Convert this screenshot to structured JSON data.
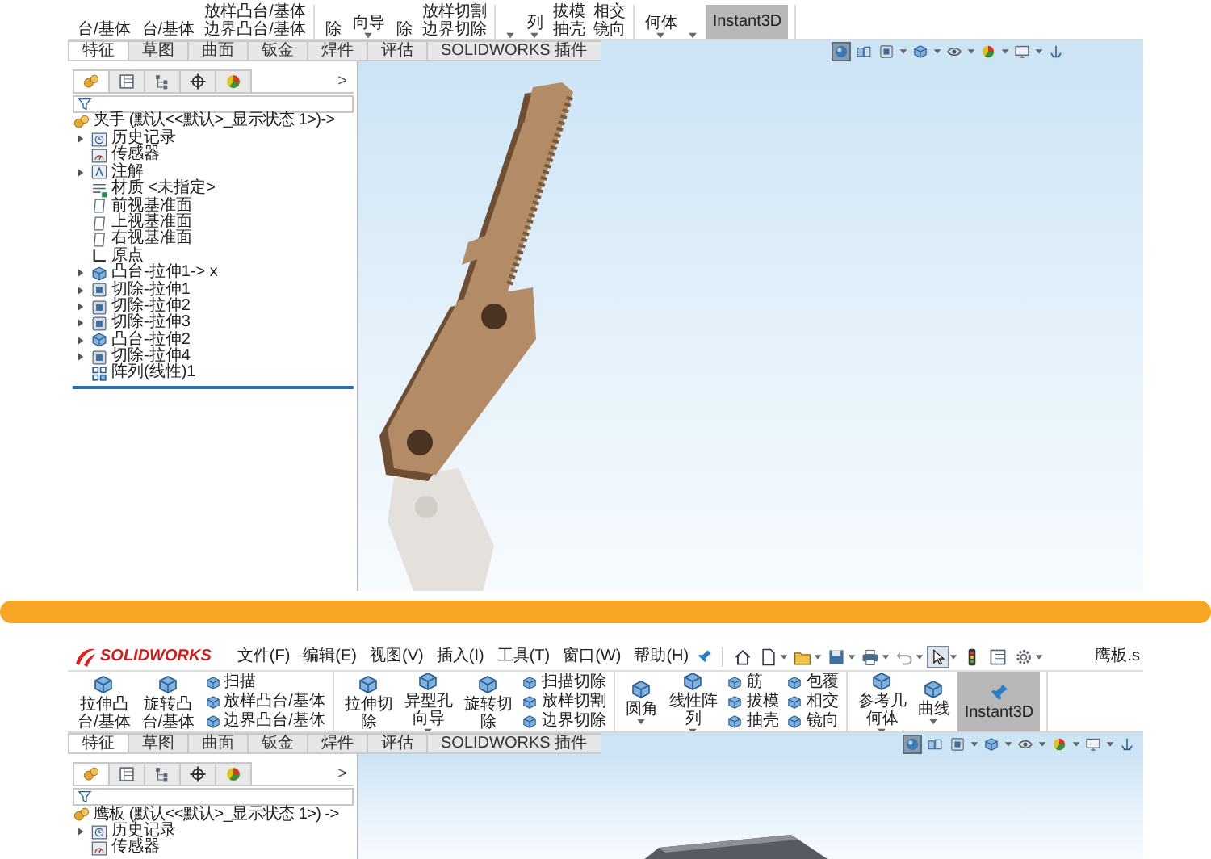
{
  "top_view": {
    "ribbon": {
      "groups": [
        [
          {
            "kind": "large",
            "lines": [
              "台/基体"
            ],
            "dropdown": false,
            "on": false
          },
          {
            "kind": "large",
            "lines": [
              "台/基体"
            ],
            "dropdown": false,
            "on": false
          },
          {
            "kind": "stack",
            "items": [
              "放样凸台/基体",
              "边界凸台/基体"
            ]
          }
        ],
        [
          {
            "kind": "large",
            "lines": [
              "除"
            ],
            "dropdown": false,
            "on": false
          },
          {
            "kind": "large",
            "lines": [
              "向导"
            ],
            "dropdown": true,
            "on": false
          },
          {
            "kind": "large",
            "lines": [
              "除"
            ],
            "dropdown": false,
            "on": false
          },
          {
            "kind": "stack",
            "items": [
              "放样切割",
              "边界切除"
            ]
          }
        ],
        [
          {
            "kind": "large",
            "dropdown": true,
            "on": false
          },
          {
            "kind": "large",
            "lines": [
              "列"
            ],
            "dropdown": true,
            "on": false
          },
          {
            "kind": "stack",
            "items": [
              "拔模",
              "抽壳"
            ]
          },
          {
            "kind": "stack",
            "items": [
              "相交",
              "镜向"
            ]
          }
        ],
        [
          {
            "kind": "large",
            "lines": [
              "何体"
            ],
            "dropdown": true,
            "on": false
          },
          {
            "kind": "large",
            "dropdown": true,
            "on": false
          },
          {
            "kind": "large",
            "lines": [
              "Instant3D"
            ],
            "dropdown": false,
            "on": true
          }
        ]
      ]
    },
    "tabs": [
      {
        "label": "特征",
        "selected": true
      },
      {
        "label": "草图",
        "selected": false
      },
      {
        "label": "曲面",
        "selected": false
      },
      {
        "label": "钣金",
        "selected": false
      },
      {
        "label": "焊件",
        "selected": false
      },
      {
        "label": "评估",
        "selected": false
      },
      {
        "label": "SOLIDWORKS 插件",
        "selected": false
      }
    ],
    "view_tools": [
      {
        "kind": "sphere",
        "selected": true,
        "dropdown": false
      },
      {
        "kind": "cubes",
        "selected": false,
        "dropdown": false
      },
      {
        "kind": "box",
        "selected": false,
        "dropdown": true
      },
      {
        "kind": "cube",
        "selected": false,
        "dropdown": true
      },
      {
        "kind": "eye",
        "selected": false,
        "dropdown": true
      },
      {
        "kind": "ball",
        "selected": false,
        "dropdown": true
      },
      {
        "kind": "monitor",
        "selected": false,
        "dropdown": true
      },
      {
        "kind": "anchor",
        "selected": false,
        "dropdown": false
      }
    ],
    "panel": {
      "tabs": [
        {
          "kind": "parts",
          "selected": true
        },
        {
          "kind": "window",
          "selected": false
        },
        {
          "kind": "nodes",
          "selected": false
        },
        {
          "kind": "crosshair",
          "selected": false
        },
        {
          "kind": "ball",
          "selected": false
        }
      ],
      "more": ">",
      "root": "夹手 (默认<<默认>_显示状态 1>)->",
      "items": [
        {
          "kind": "clock",
          "label": "历史记录",
          "expandable": true
        },
        {
          "kind": "gauge",
          "label": "传感器",
          "expandable": false
        },
        {
          "kind": "triangle",
          "label": "注解",
          "expandable": true
        },
        {
          "kind": "list",
          "label": "材质 <未指定>",
          "expandable": false
        },
        {
          "kind": "plane",
          "label": "前视基准面",
          "expandable": false
        },
        {
          "kind": "plane",
          "label": "上视基准面",
          "expandable": false
        },
        {
          "kind": "plane",
          "label": "右视基准面",
          "expandable": false
        },
        {
          "kind": "axes",
          "label": "原点",
          "expandable": false
        },
        {
          "kind": "cube",
          "label": "凸台-拉伸1-> x",
          "expandable": true
        },
        {
          "kind": "box",
          "label": "切除-拉伸1",
          "expandable": true
        },
        {
          "kind": "box",
          "label": "切除-拉伸2",
          "expandable": true
        },
        {
          "kind": "box",
          "label": "切除-拉伸3",
          "expandable": true
        },
        {
          "kind": "cube",
          "label": "凸台-拉伸2",
          "expandable": true
        },
        {
          "kind": "box",
          "label": "切除-拉伸4",
          "expandable": true
        },
        {
          "kind": "grid",
          "label": "阵列(线性)1",
          "expandable": false
        }
      ]
    }
  },
  "bottom_view": {
    "title_bar": {
      "logo": "SOLIDWORKS",
      "menus": [
        "文件(F)",
        "编辑(E)",
        "视图(V)",
        "插入(I)",
        "工具(T)",
        "窗口(W)",
        "帮助(H)"
      ],
      "quick_access": [
        {
          "kind": "home",
          "selected": false,
          "dropdown": false
        },
        {
          "kind": "page",
          "selected": false,
          "dropdown": true
        },
        {
          "kind": "folder",
          "selected": false,
          "dropdown": true
        },
        {
          "kind": "disk",
          "selected": false,
          "dropdown": true
        },
        {
          "kind": "printer",
          "selected": false,
          "dropdown": true
        },
        {
          "kind": "undo",
          "selected": false,
          "dropdown": true
        },
        {
          "kind": "cursor",
          "selected": true,
          "dropdown": true
        },
        {
          "kind": "light",
          "selected": false,
          "dropdown": false
        },
        {
          "kind": "window",
          "selected": false,
          "dropdown": false
        },
        {
          "kind": "gear",
          "selected": false,
          "dropdown": true
        }
      ],
      "document": "鹰板.s"
    },
    "ribbon": {
      "groups": [
        [
          {
            "kind": "large",
            "lines": [
              "拉伸凸",
              "台/基体"
            ],
            "dropdown": false,
            "on": false
          },
          {
            "kind": "large",
            "lines": [
              "旋转凸",
              "台/基体"
            ],
            "dropdown": false,
            "on": false
          },
          {
            "kind": "stack",
            "items": [
              "扫描",
              "放样凸台/基体",
              "边界凸台/基体"
            ]
          }
        ],
        [
          {
            "kind": "large",
            "lines": [
              "拉伸切",
              "除"
            ],
            "dropdown": false,
            "on": false
          },
          {
            "kind": "large",
            "lines": [
              "异型孔",
              "向导"
            ],
            "dropdown": true,
            "on": false
          },
          {
            "kind": "large",
            "lines": [
              "旋转切",
              "除"
            ],
            "dropdown": false,
            "on": false
          },
          {
            "kind": "stack",
            "items": [
              "扫描切除",
              "放样切割",
              "边界切除"
            ]
          }
        ],
        [
          {
            "kind": "large",
            "lines": [
              "圆角"
            ],
            "dropdown": true,
            "on": false
          },
          {
            "kind": "large",
            "lines": [
              "线性阵",
              "列"
            ],
            "dropdown": true,
            "on": false
          },
          {
            "kind": "stack",
            "items": [
              "筋",
              "拔模",
              "抽壳"
            ]
          },
          {
            "kind": "stack",
            "items": [
              "包覆",
              "相交",
              "镜向"
            ]
          }
        ],
        [
          {
            "kind": "large",
            "lines": [
              "参考几",
              "何体"
            ],
            "dropdown": true,
            "on": false
          },
          {
            "kind": "large",
            "lines": [
              "曲线"
            ],
            "dropdown": true,
            "on": false
          },
          {
            "kind": "large",
            "lines": [
              "Instant3D"
            ],
            "dropdown": false,
            "on": true
          }
        ]
      ]
    },
    "tabs": [
      {
        "label": "特征",
        "selected": true
      },
      {
        "label": "草图",
        "selected": false
      },
      {
        "label": "曲面",
        "selected": false
      },
      {
        "label": "钣金",
        "selected": false
      },
      {
        "label": "焊件",
        "selected": false
      },
      {
        "label": "评估",
        "selected": false
      },
      {
        "label": "SOLIDWORKS 插件",
        "selected": false
      }
    ],
    "view_tools": [
      {
        "kind": "sphere",
        "selected": true,
        "dropdown": false
      },
      {
        "kind": "cubes",
        "selected": false,
        "dropdown": false
      },
      {
        "kind": "box",
        "selected": false,
        "dropdown": true
      },
      {
        "kind": "cube",
        "selected": false,
        "dropdown": true
      },
      {
        "kind": "eye",
        "selected": false,
        "dropdown": true
      },
      {
        "kind": "ball",
        "selected": false,
        "dropdown": true
      },
      {
        "kind": "monitor",
        "selected": false,
        "dropdown": true
      },
      {
        "kind": "anchor",
        "selected": false,
        "dropdown": false
      }
    ],
    "panel": {
      "tabs": [
        {
          "kind": "parts",
          "selected": true
        },
        {
          "kind": "window",
          "selected": false
        },
        {
          "kind": "nodes",
          "selected": false
        },
        {
          "kind": "crosshair",
          "selected": false
        },
        {
          "kind": "ball",
          "selected": false
        }
      ],
      "more": ">",
      "root": "鹰板 (默认<<默认>_显示状态 1>) ->",
      "items": [
        {
          "kind": "clock",
          "label": "历史记录",
          "expandable": true
        },
        {
          "kind": "gauge",
          "label": "传感器",
          "expandable": false
        }
      ]
    }
  }
}
